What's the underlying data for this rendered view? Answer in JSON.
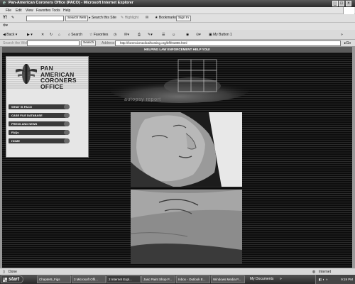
{
  "window": {
    "title": "Pan-American Coroners Office (PACO) - Microsoft Internet Explorer"
  },
  "menu": [
    "File",
    "Edit",
    "View",
    "Favorites",
    "Tools",
    "Help"
  ],
  "toolbar": {
    "search_web": "Search Web",
    "search_site": "Search this Site",
    "highlight": "Highlight",
    "bookmarks": "Bookmarks",
    "sign_in": "Sign In"
  },
  "nav": {
    "back": "Back",
    "search": "Search",
    "favorites": "Favorites",
    "my_button": "My Button 1"
  },
  "address": {
    "search_placeholder": "Search the Web",
    "search_btn": "Search",
    "label": "Address",
    "url": "http://forensicmedicalhosting.org/bff/01808.html",
    "go": "Go"
  },
  "page": {
    "banner": "HELPING LAW ENFORCEMENT HELP YOU!",
    "logo_lines": [
      "PAN",
      "AMERICAN",
      "CORONERS",
      "OFFICE"
    ],
    "menu_items": [
      "WHAT IS PACO",
      "CASE FILE DATABASE",
      "PRESS AND NEWS",
      "FAQs",
      "HOME"
    ],
    "header_graphic_text": "autopsy report"
  },
  "status": {
    "left": "Done",
    "zone": "Internet"
  },
  "taskbar": {
    "start": "start",
    "tasks": [
      "Chapter9_Figs",
      "3 Microsoft Offi...",
      "2 Internet Expl...",
      "Jasc Paint Shop P...",
      "Inbox - Outlook E...",
      "Windows Media P..."
    ],
    "tray_label": "My Documents",
    "clock": "9:19 PM"
  },
  "colors": {
    "page_bg": "#151515",
    "menu_button": "#3a3a3a",
    "chrome": "#e0e0e0"
  }
}
